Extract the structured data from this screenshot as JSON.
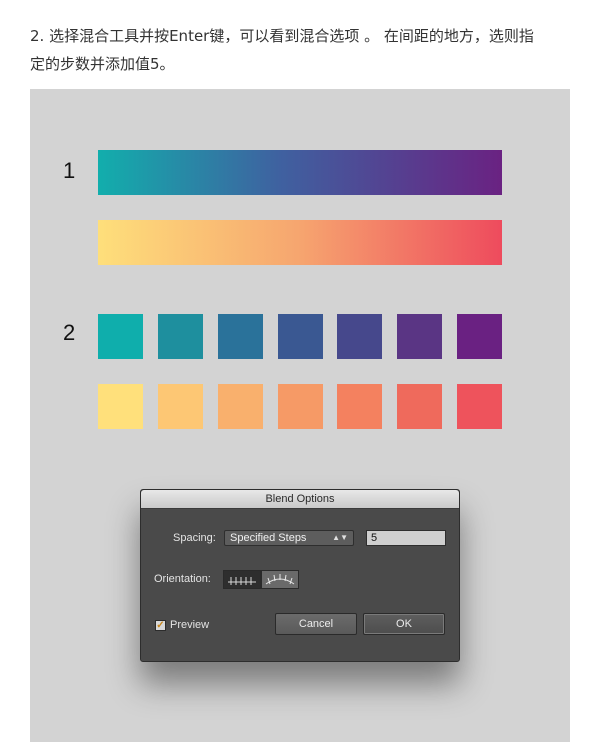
{
  "caption": {
    "line1": "2. 选择混合工具并按Enter键，可以看到混合选项 。 在间距的地方，选则指",
    "line2": "定的步数并添加值5。"
  },
  "artwork": {
    "label_1": "1",
    "label_2": "2",
    "cool_squares": [
      "#0faeac",
      "#1e8f9e",
      "#2a729a",
      "#3a5892",
      "#46488c",
      "#5a3584",
      "#6a2182"
    ],
    "warm_squares": [
      "#ffe07b",
      "#fdc774",
      "#f9b06d",
      "#f69a66",
      "#f4815f",
      "#ef6a5c",
      "#ee535c"
    ]
  },
  "dialog": {
    "title": "Blend Options",
    "spacing_label": "Spacing:",
    "spacing_value": "Specified Steps",
    "steps_value": "5",
    "orientation_label": "Orientation:",
    "preview_label": "Preview",
    "preview_checked": true,
    "cancel_label": "Cancel",
    "ok_label": "OK"
  }
}
